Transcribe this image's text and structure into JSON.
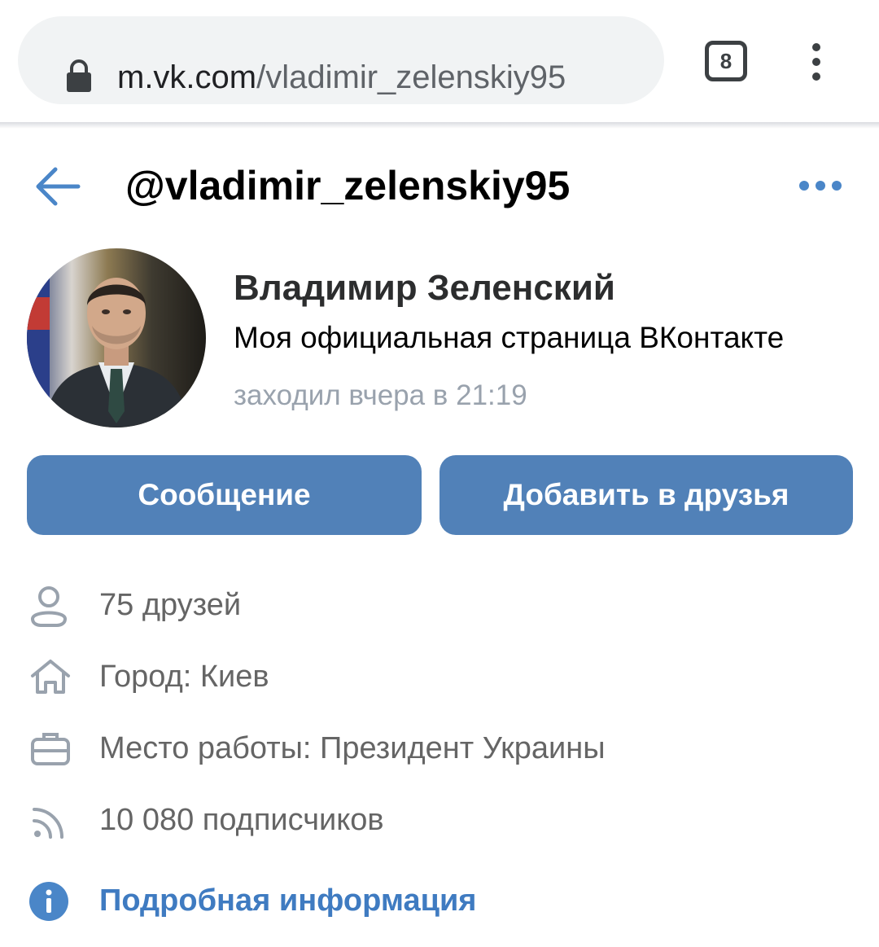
{
  "browser": {
    "url_domain": "m.vk.com",
    "url_path": "/vladimir_zelenskiy95",
    "tab_count": "8",
    "icons": [
      "lock-icon",
      "tabs-icon",
      "kebab-menu-icon"
    ]
  },
  "header": {
    "handle": "@vladimir_zelenskiy95",
    "icons": [
      "back-arrow-icon",
      "more-dots-icon"
    ]
  },
  "profile": {
    "name": "Владимир Зеленский",
    "status": "Моя официальная страница ВКонтакте",
    "last_seen": "заходил вчера в 21:19"
  },
  "actions": {
    "message_label": "Сообщение",
    "add_friend_label": "Добавить в друзья"
  },
  "info": {
    "friends": "75 друзей",
    "city": "Город: Киев",
    "work": "Место работы: Президент Украины",
    "subscribers": "10 080 подписчиков",
    "details_link": "Подробная информация"
  },
  "colors": {
    "accent": "#5181b8",
    "link": "#3f7bc1",
    "secondary_text": "#99a2ad",
    "icon_gray": "#99a2ad"
  }
}
